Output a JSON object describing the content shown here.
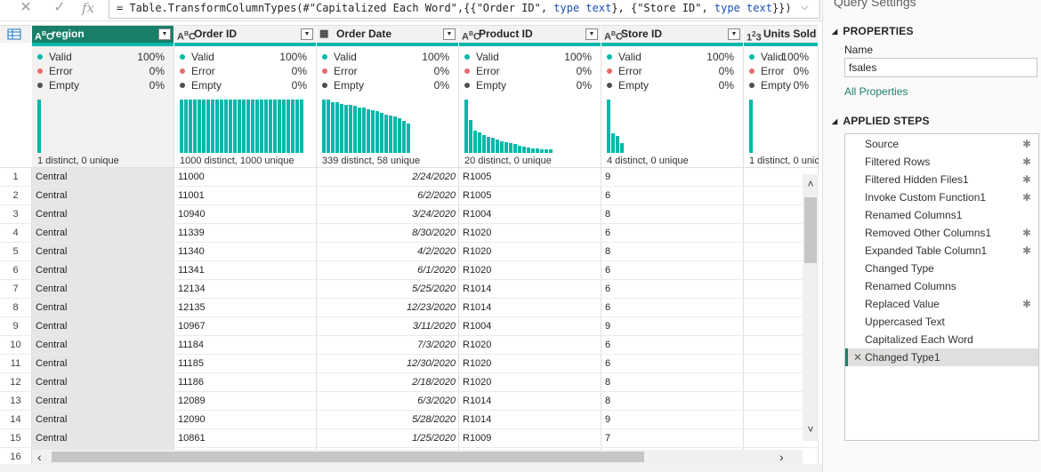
{
  "formula_bar": {
    "cancel_icon": "x-icon",
    "confirm_icon": "check-icon",
    "fx_label": "fx",
    "formula_prefix": "= Table.TransformColumnTypes(#\"Capitalized Each Word\",{{\"Order ID\", ",
    "kw1": "type text",
    "mid": "}, {\"Store ID\", ",
    "kw2": "type text",
    "suffix": "}})"
  },
  "columns": [
    {
      "type_icon": "ABC",
      "title": "region",
      "valid": "100%",
      "error": "0%",
      "empty": "0%",
      "distinct": "1 distinct, 0 unique",
      "selected": true
    },
    {
      "type_icon": "ABC",
      "title": "Order ID",
      "valid": "100%",
      "error": "0%",
      "empty": "0%",
      "distinct": "1000 distinct, 1000 unique"
    },
    {
      "type_icon": "calendar",
      "title": "Order Date",
      "valid": "100%",
      "error": "0%",
      "empty": "0%",
      "distinct": "339 distinct, 58 unique"
    },
    {
      "type_icon": "ABC",
      "title": "Product ID",
      "valid": "100%",
      "error": "0%",
      "empty": "0%",
      "distinct": "20 distinct, 0 unique"
    },
    {
      "type_icon": "ABC",
      "title": "Store ID",
      "valid": "100%",
      "error": "0%",
      "empty": "0%",
      "distinct": "4 distinct, 0 unique"
    },
    {
      "type_icon": "123",
      "title": "Units Sold",
      "valid": "100%",
      "error": "0%",
      "empty": "0%",
      "distinct": "1 distinct, 0 unic"
    }
  ],
  "quality_labels": {
    "valid": "Valid",
    "error": "Error",
    "empty": "Empty"
  },
  "colors": {
    "accent": "#01b8aa",
    "selected_header": "#1a7f6a",
    "error_dot": "#e66c6c",
    "empty_dot": "#505050"
  },
  "rows": [
    {
      "n": "1",
      "region": "Central",
      "order_id": "11000",
      "date": "2/24/2020",
      "product": "R1005",
      "store": "9"
    },
    {
      "n": "2",
      "region": "Central",
      "order_id": "11001",
      "date": "6/2/2020",
      "product": "R1005",
      "store": "6"
    },
    {
      "n": "3",
      "region": "Central",
      "order_id": "10940",
      "date": "3/24/2020",
      "product": "R1004",
      "store": "8"
    },
    {
      "n": "4",
      "region": "Central",
      "order_id": "11339",
      "date": "8/30/2020",
      "product": "R1020",
      "store": "6"
    },
    {
      "n": "5",
      "region": "Central",
      "order_id": "11340",
      "date": "4/2/2020",
      "product": "R1020",
      "store": "8"
    },
    {
      "n": "6",
      "region": "Central",
      "order_id": "11341",
      "date": "6/1/2020",
      "product": "R1020",
      "store": "6"
    },
    {
      "n": "7",
      "region": "Central",
      "order_id": "12134",
      "date": "5/25/2020",
      "product": "R1014",
      "store": "6"
    },
    {
      "n": "8",
      "region": "Central",
      "order_id": "12135",
      "date": "12/23/2020",
      "product": "R1014",
      "store": "6"
    },
    {
      "n": "9",
      "region": "Central",
      "order_id": "10967",
      "date": "3/11/2020",
      "product": "R1004",
      "store": "9"
    },
    {
      "n": "10",
      "region": "Central",
      "order_id": "11184",
      "date": "7/3/2020",
      "product": "R1020",
      "store": "6"
    },
    {
      "n": "11",
      "region": "Central",
      "order_id": "11185",
      "date": "12/30/2020",
      "product": "R1020",
      "store": "6"
    },
    {
      "n": "12",
      "region": "Central",
      "order_id": "11186",
      "date": "2/18/2020",
      "product": "R1020",
      "store": "8"
    },
    {
      "n": "13",
      "region": "Central",
      "order_id": "12089",
      "date": "6/3/2020",
      "product": "R1014",
      "store": "8"
    },
    {
      "n": "14",
      "region": "Central",
      "order_id": "12090",
      "date": "5/28/2020",
      "product": "R1014",
      "store": "9"
    },
    {
      "n": "15",
      "region": "Central",
      "order_id": "10861",
      "date": "1/25/2020",
      "product": "R1009",
      "store": "7"
    },
    {
      "n": "16",
      "region": "",
      "order_id": "",
      "date": "",
      "product": "",
      "store": ""
    }
  ],
  "query_settings": {
    "title": "Query Settings",
    "properties_heading": "PROPERTIES",
    "name_label": "Name",
    "name_value": "fsales",
    "all_properties": "All Properties",
    "applied_steps_heading": "APPLIED STEPS",
    "steps": [
      {
        "label": "Source",
        "gear": true
      },
      {
        "label": "Filtered Rows",
        "gear": true
      },
      {
        "label": "Filtered Hidden Files1",
        "gear": true
      },
      {
        "label": "Invoke Custom Function1",
        "gear": true
      },
      {
        "label": "Renamed Columns1",
        "gear": false
      },
      {
        "label": "Removed Other Columns1",
        "gear": true
      },
      {
        "label": "Expanded Table Column1",
        "gear": true
      },
      {
        "label": "Changed Type",
        "gear": false
      },
      {
        "label": "Renamed Columns",
        "gear": false
      },
      {
        "label": "Replaced Value",
        "gear": true
      },
      {
        "label": "Uppercased Text",
        "gear": false
      },
      {
        "label": "Capitalized Each Word",
        "gear": false
      },
      {
        "label": "Changed Type1",
        "gear": false,
        "active": true
      }
    ]
  }
}
